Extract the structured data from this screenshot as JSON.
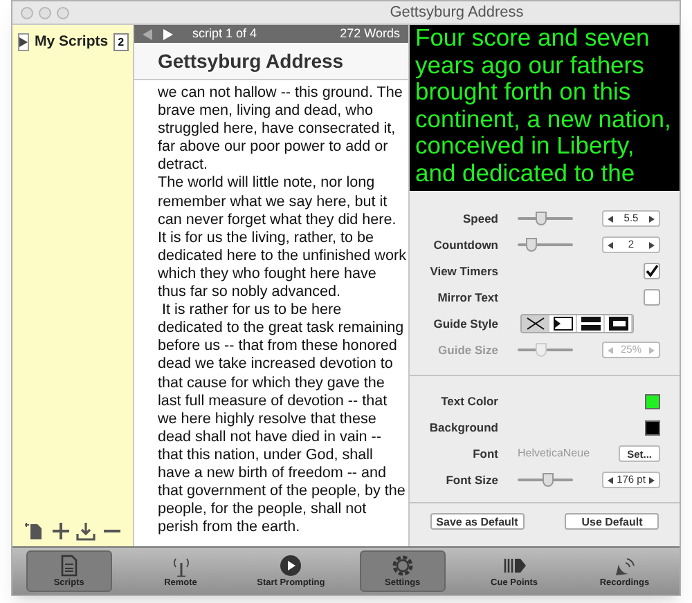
{
  "window": {
    "title": "Gettsyburg Address"
  },
  "sidebar": {
    "title": "My Scripts",
    "badge": "2",
    "expanded": false
  },
  "script_bar": {
    "position": "script 1 of 4",
    "word_count": "272 Words"
  },
  "script": {
    "title": "Gettsyburg Address",
    "paragraphs": [
      "we can not hallow -- this ground. The brave men, living and dead, who struggled here, have consecrated it, far above our poor power to add or detract.",
      "The world will little note, nor long remember what we say here, but it can never forget what they did here. It is for us the living, rather, to be dedicated here to the unfinished work which they who fought here have thus far so nobly advanced.",
      " It is rather for us to be here dedicated to the great task remaining before us -- that from these honored dead we take increased devotion to that cause for which they gave the last full measure of devotion -- that we here highly resolve that these dead shall not have died in vain -- that this nation, under God, shall have a new birth of freedom -- and that government of the people, by the people, for the people, shall not perish from the earth."
    ]
  },
  "preview": {
    "text": "Four score and seven years ago our fathers brought forth on this continent, a new nation, conceived in Liberty, and dedicated to the"
  },
  "settings": [
    {
      "kind": "slider",
      "label": "Speed",
      "level": 0.4,
      "value": "5.5",
      "disabled": false
    },
    {
      "kind": "slider",
      "label": "Countdown",
      "level": 0.2,
      "value": "2",
      "disabled": false
    },
    {
      "kind": "checkbox",
      "label": "View Timers",
      "checked": true
    },
    {
      "kind": "checkbox",
      "label": "Mirror Text",
      "checked": false
    },
    {
      "kind": "segmented",
      "label": "Guide Style",
      "options": [
        {
          "selected": true
        },
        {
          "selected": false
        },
        {
          "selected": false
        },
        {
          "selected": false
        }
      ]
    },
    {
      "kind": "slider",
      "label": "Guide Size",
      "level": 0.4,
      "value": "25%",
      "disabled": true
    }
  ],
  "appearance": [
    {
      "kind": "swatch",
      "label": "Text Color",
      "color": "#22ee22"
    },
    {
      "kind": "swatch",
      "label": "Background",
      "color": "#000000"
    },
    {
      "kind": "font",
      "label": "Font",
      "value": "HelveticaNeue",
      "button": "Set..."
    },
    {
      "kind": "slider",
      "label": "Font Size",
      "level": 0.55,
      "value": "176 pt",
      "disabled": false
    }
  ],
  "buttons": [
    "Save as Default",
    "Use Default"
  ],
  "toolbar": [
    {
      "label": "Scripts",
      "selected": true
    },
    {
      "label": "Remote",
      "selected": false
    },
    {
      "label": "Start Prompting",
      "selected": false
    },
    {
      "label": "Settings",
      "selected": true
    },
    {
      "label": "Cue Points",
      "selected": false
    },
    {
      "label": "Recordings",
      "selected": false
    }
  ]
}
